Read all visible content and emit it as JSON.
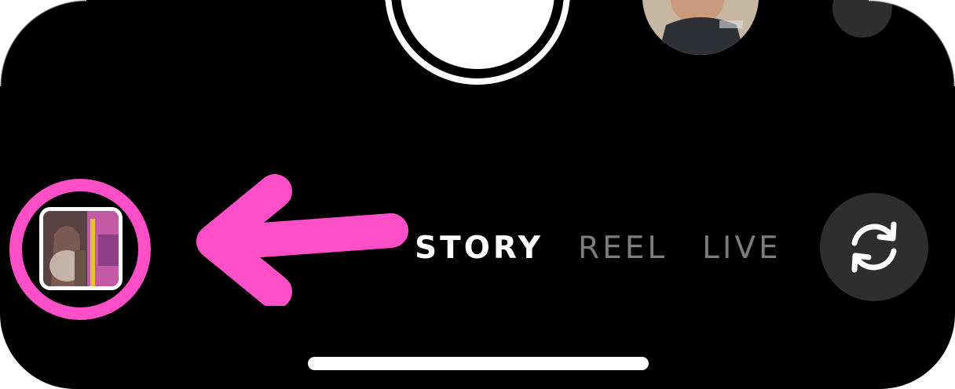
{
  "camera": {
    "modes": [
      {
        "label": "STORY",
        "active": true
      },
      {
        "label": "REEL",
        "active": false
      },
      {
        "label": "LIVE",
        "active": false
      }
    ]
  },
  "icons": {
    "flip_camera": "camera-flip-icon",
    "gallery": "gallery-thumbnail",
    "annotation": "arrow-left-icon"
  },
  "colors": {
    "background": "#000000",
    "annotation": "#ff4fc8",
    "active_mode": "#ffffff",
    "inactive_mode": "#7d7d7d",
    "control_fill": "#2e2e2e"
  }
}
